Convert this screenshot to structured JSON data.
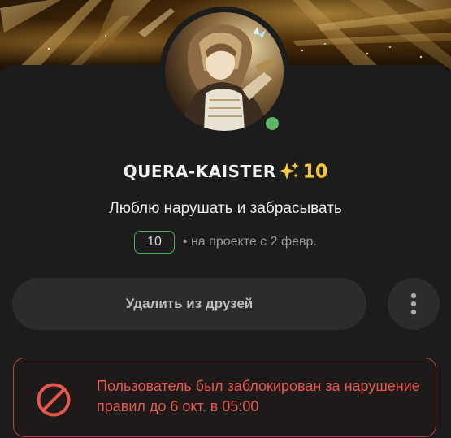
{
  "profile": {
    "username": "QUERA-KAISTER",
    "sparkle_emoji": "✨",
    "level_badge": "10",
    "bio": "Люблю нарушать и забрасывать",
    "level": "10",
    "member_since": "• на проекте с 2 февр.",
    "online": true,
    "avatar_icon": "anime-avatar-image",
    "status_color": "#5fb56a"
  },
  "actions": {
    "unfriend_label": "Удалить из друзей",
    "more_icon": "vertical-dots-icon"
  },
  "ban_notice": {
    "icon": "block-icon",
    "text": "Пользователь был заблокирован за нарушение правил до 6 окт. в 05:00",
    "color": "#e4584e"
  }
}
